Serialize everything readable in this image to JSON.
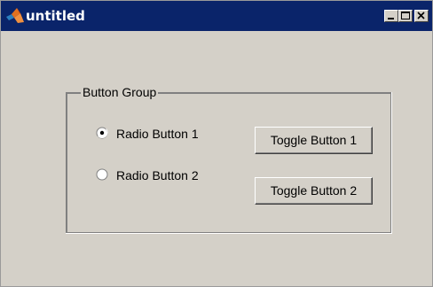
{
  "window": {
    "title": "untitled",
    "title_bar_color": "#0a246a",
    "background_color": "#d4d0c8",
    "icon": "matlab-logo-icon",
    "controls": {
      "minimize": "minimize-icon",
      "maximize": "maximize-icon",
      "close": "close-icon"
    }
  },
  "button_group": {
    "title": "Button Group",
    "radios": [
      {
        "label": "Radio Button 1",
        "selected": true
      },
      {
        "label": "Radio Button 2",
        "selected": false
      }
    ],
    "toggles": [
      {
        "label": "Toggle Button 1",
        "pressed": false
      },
      {
        "label": "Toggle Button 2",
        "pressed": false
      }
    ]
  }
}
